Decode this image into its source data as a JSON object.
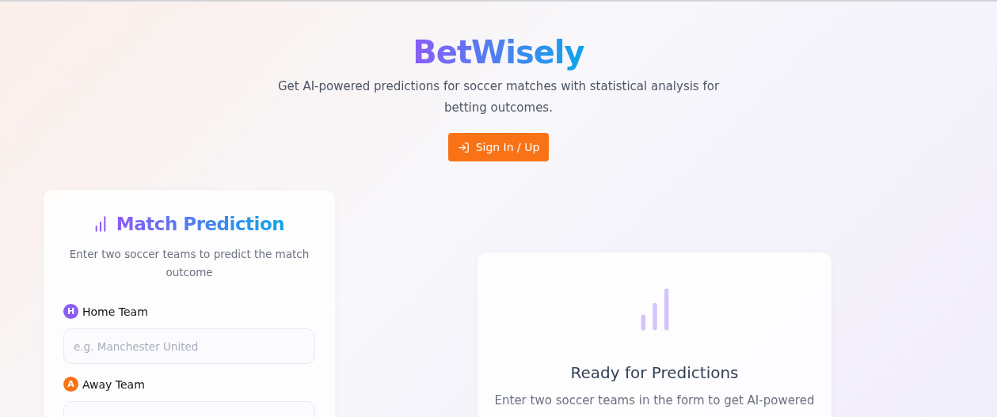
{
  "header": {
    "title": "BetWisely",
    "subtitle": "Get AI-powered predictions for soccer matches with statistical analysis for betting outcomes.",
    "sign_in_button": "Sign In / Up"
  },
  "form_card": {
    "title": "Match Prediction",
    "description": "Enter two soccer teams to predict the match outcome",
    "fields": [
      {
        "badge": "H",
        "label": "Home Team",
        "color": "#8b5cf6",
        "placeholder": "e.g. Manchester United"
      },
      {
        "badge": "A",
        "label": "Away Team",
        "color": "#f97316"
      }
    ]
  },
  "result_card": {
    "title": "Ready for Predictions",
    "description": "Enter two soccer teams in the form to get AI-powered"
  }
}
